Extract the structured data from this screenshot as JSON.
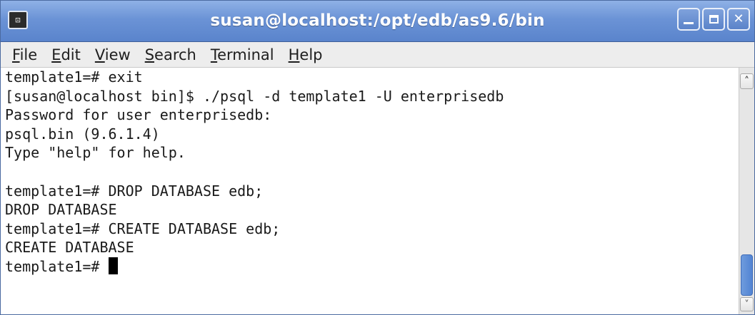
{
  "window": {
    "title": "susan@localhost:/opt/edb/as9.6/bin",
    "app_icon": "terminal-icon",
    "app_icon_glyph": "⊡",
    "buttons": {
      "minimize_icon": "minimize-icon",
      "maximize_icon": "maximize-icon",
      "close_icon": "close-icon",
      "close_glyph": "✕"
    }
  },
  "menu": {
    "items": [
      {
        "mnemonic": "F",
        "rest": "ile"
      },
      {
        "mnemonic": "E",
        "rest": "dit"
      },
      {
        "mnemonic": "V",
        "rest": "iew"
      },
      {
        "mnemonic": "S",
        "rest": "earch"
      },
      {
        "mnemonic": "T",
        "rest": "erminal"
      },
      {
        "mnemonic": "H",
        "rest": "elp"
      }
    ]
  },
  "terminal": {
    "lines": [
      "template1=# exit",
      "[susan@localhost bin]$ ./psql -d template1 -U enterprisedb",
      "Password for user enterprisedb:",
      "psql.bin (9.6.1.4)",
      "Type \"help\" for help.",
      "",
      "template1=# DROP DATABASE edb;",
      "DROP DATABASE",
      "template1=# CREATE DATABASE edb;",
      "CREATE DATABASE",
      "template1=# "
    ]
  },
  "scrollbar": {
    "up_glyph": "˄",
    "down_glyph": "˅",
    "position": "bottom"
  },
  "colors": {
    "titlebar": "#6b93d6",
    "cursor": "#000000",
    "scroll_thumb": "#5284d3"
  }
}
